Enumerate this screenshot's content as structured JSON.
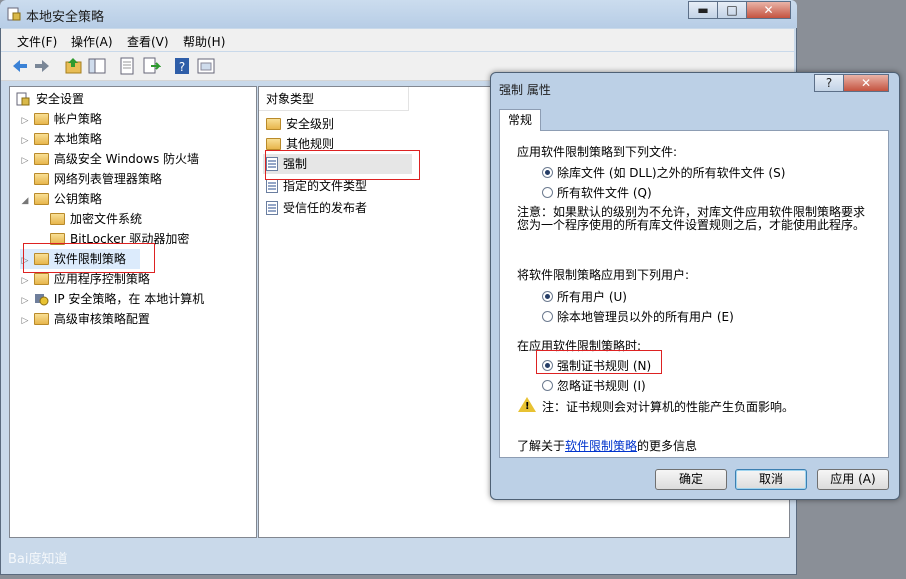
{
  "main_window": {
    "title": "本地安全策略",
    "controls": {
      "minimize": "▬",
      "maximize": "□",
      "close": "✕"
    },
    "menu": [
      "文件(F)",
      "操作(A)",
      "查看(V)",
      "帮助(H)"
    ],
    "toolbar_icons": [
      "back-arrow-icon",
      "forward-arrow-icon",
      "up-folder-icon",
      "show-tree-icon",
      "properties-icon",
      "export-icon",
      "help-icon",
      "console-icon"
    ]
  },
  "tree": {
    "root": "安全设置",
    "items": [
      {
        "label": "帐户策略"
      },
      {
        "label": "本地策略"
      },
      {
        "label": "高级安全 Windows 防火墙"
      },
      {
        "label": "网络列表管理器策略"
      },
      {
        "label": "公钥策略"
      },
      {
        "label": "加密文件系统"
      },
      {
        "label": "BitLocker 驱动器加密"
      },
      {
        "label": "软件限制策略"
      },
      {
        "label": "应用程序控制策略"
      },
      {
        "label": "IP 安全策略，在 本地计算机"
      },
      {
        "label": "高级审核策略配置"
      }
    ]
  },
  "list": {
    "column_header": "对象类型",
    "items": [
      {
        "label": "安全级别"
      },
      {
        "label": "其他规则"
      },
      {
        "label": "强制"
      },
      {
        "label": "指定的文件类型"
      },
      {
        "label": "受信任的发布者"
      }
    ]
  },
  "dialog": {
    "title": "强制 属性",
    "help_button": "?",
    "close_button": "✕",
    "tab": "常规",
    "section1_heading": "应用软件限制策略到下列文件:",
    "section1_options": [
      "除库文件 (如 DLL)之外的所有软件文件 (S)",
      "所有软件文件 (Q)"
    ],
    "note_line1": "注意：如果默认的级别为不允许，对库文件应用软件限制策略要求",
    "note_line2": "您为一个程序使用的所有库文件设置规则之后，才能使用此程序。",
    "section2_heading": "将软件限制策略应用到下列用户:",
    "section2_options": [
      "所有用户 (U)",
      "除本地管理员以外的所有用户 (E)"
    ],
    "section3_heading": "在应用软件限制策略时:",
    "section3_options": [
      "强制证书规则 (N)",
      "忽略证书规则 (I)"
    ],
    "warning_text": "注：证书规则会对计算机的性能产生负面影响。",
    "learn_prefix": "了解关于",
    "learn_link": "软件限制策略",
    "learn_suffix": "的更多信息",
    "buttons": {
      "ok": "确定",
      "cancel": "取消",
      "apply": "应用 (A)"
    }
  },
  "watermark": "Bai度知道"
}
